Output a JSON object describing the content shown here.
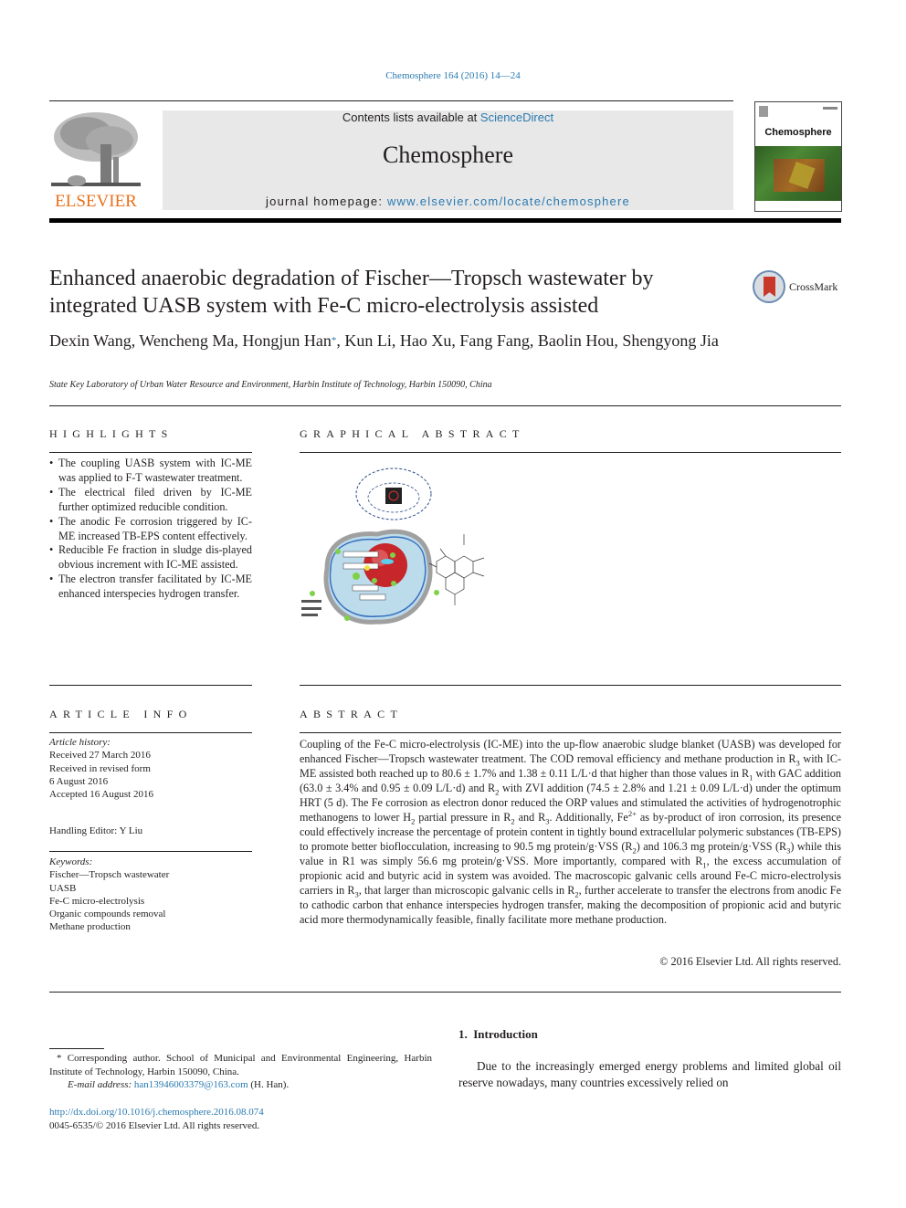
{
  "header": {
    "citation": "Chemosphere 164 (2016) 14—24",
    "publisher_logo_text": "ELSEVIER",
    "contents_prefix": "Contents lists available at ",
    "contents_link": "ScienceDirect",
    "journal_title": "Chemosphere",
    "homepage_prefix": "journal homepage: ",
    "homepage_link": "www.elsevier.com/locate/chemosphere",
    "cover_title": "Chemosphere"
  },
  "article": {
    "title": "Enhanced anaerobic degradation of Fischer—Tropsch wastewater by integrated UASB system with Fe-C micro-electrolysis assisted",
    "crossmark_label": "CrossMark",
    "authors_part1": "Dexin Wang, Wencheng Ma, Hongjun Han",
    "corresponding_marker": "*",
    "authors_part2": ", Kun Li, Hao Xu, Fang Fang, Baolin Hou, Shengyong Jia",
    "affiliation": "State Key Laboratory of Urban Water Resource and Environment, Harbin Institute of Technology, Harbin 150090, China"
  },
  "highlights": {
    "heading": "HIGHLIGHTS",
    "items": [
      "The coupling UASB system with IC-ME was applied to F-T wastewater treatment.",
      "The electrical filed driven by IC-ME further optimized reducible condition.",
      "The anodic Fe corrosion triggered by IC-ME increased TB-EPS content effectively.",
      "Reducible Fe fraction in sludge dis-played obvious increment with IC-ME assisted.",
      "The electron transfer facilitated by IC-ME enhanced interspecies hydrogen transfer."
    ]
  },
  "graphical_abstract": {
    "heading": "GRAPHICAL ABSTRACT"
  },
  "article_info": {
    "heading": "ARTICLE INFO",
    "history_label": "Article history:",
    "history": [
      "Received 27 March 2016",
      "Received in revised form",
      "6 August 2016",
      "Accepted 16 August 2016"
    ],
    "handling_editor": "Handling Editor: Y Liu",
    "keywords_label": "Keywords:",
    "keywords": [
      "Fischer—Tropsch wastewater",
      "UASB",
      "Fe-C micro-electrolysis",
      "Organic compounds removal",
      "Methane production"
    ]
  },
  "abstract": {
    "heading": "ABSTRACT",
    "segments": {
      "s1": "Coupling of the Fe-C micro-electrolysis (IC-ME) into the up-flow anaerobic sludge blanket (UASB) was developed for enhanced Fischer—Tropsch wastewater treatment. The COD removal efficiency and methane production in R",
      "sub3a": "3",
      "s2": " with IC-ME assisted both reached up to 80.6 ± 1.7% and 1.38 ± 0.11 L/L·d that higher than those values in R",
      "sub1a": "1",
      "s3": " with GAC addition (63.0 ± 3.4% and 0.95 ± 0.09 L/L·d) and R",
      "sub2a": "2",
      "s4": " with ZVI addition (74.5 ± 2.8% and 1.21 ± 0.09 L/L·d) under the optimum HRT (5 d). The Fe corrosion as electron donor reduced the ORP values and stimulated the activities of hydrogenotrophic methanogens to lower H",
      "sub2b": "2",
      "s5": " partial pressure in R",
      "sub2c": "2",
      "s6": " and R",
      "sub3b": "3",
      "s7": ". Additionally, Fe",
      "sup2p": "2+",
      "s8": " as by-product of iron corrosion, its presence could effectively increase the percentage of protein content in tightly bound extracellular polymeric substances (TB-EPS) to promote better bioflocculation, increasing to 90.5 mg protein/g·VSS (R",
      "sub2d": "2",
      "s9": ") and 106.3 mg protein/g·VSS (R",
      "sub3c": "3",
      "s10": ") while this value in R1 was simply 56.6 mg protein/g·VSS. More importantly, compared with R",
      "sub1b": "1",
      "s11": ", the excess accumulation of propionic acid and butyric acid in system was avoided. The macroscopic galvanic cells around Fe-C micro-electrolysis carriers in R",
      "sub3d": "3",
      "s12": ", that larger than microscopic galvanic cells in R",
      "sub2e": "2",
      "s13": ", further accelerate to transfer the electrons from anodic Fe to cathodic carbon that enhance interspecies hydrogen transfer, making the decomposition of propionic acid and butyric acid more thermodynamically feasible, finally facilitate more methane production."
    },
    "copyright": "© 2016 Elsevier Ltd. All rights reserved."
  },
  "footnotes": {
    "corresponding": "* Corresponding author. School of Municipal and Environmental Engineering, Harbin Institute of Technology, Harbin 150090, China.",
    "email_label": "E-mail address: ",
    "email": "han13946003379@163.com",
    "email_suffix": " (H. Han).",
    "doi": "http://dx.doi.org/10.1016/j.chemosphere.2016.08.074",
    "issn_copyright": "0045-6535/© 2016 Elsevier Ltd. All rights reserved."
  },
  "introduction": {
    "heading": "1.  Introduction",
    "text": "Due to the increasingly emerged energy problems and limited global oil reserve nowadays, many countries excessively relied on"
  },
  "colors": {
    "link": "#2a7ab0",
    "elsevier_orange": "#e9711c",
    "masthead_bg": "#e8e8e8",
    "text": "#231f20"
  }
}
